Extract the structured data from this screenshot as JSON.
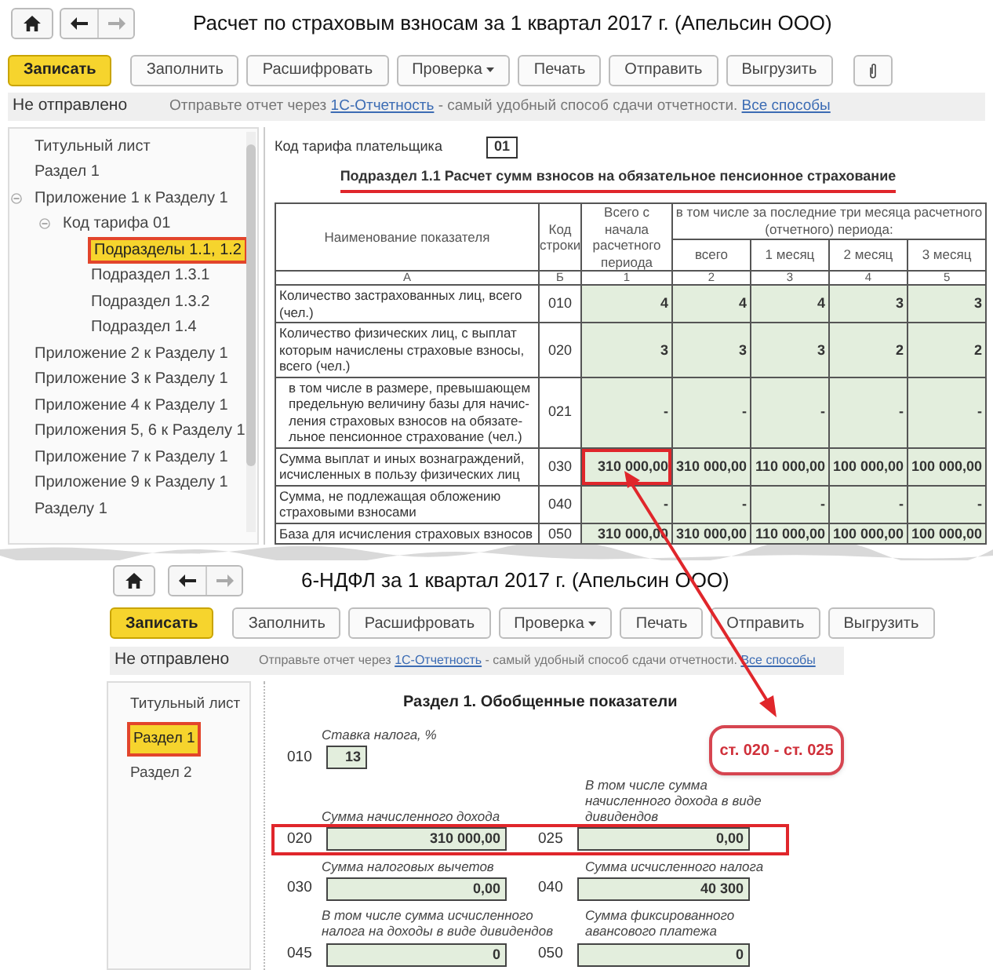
{
  "report_1": {
    "title": "Расчет по страховым взносам за 1 квартал 2017 г. (Апельсин ООО)",
    "toolbar": [
      {
        "label": "Записать",
        "kind": "primary"
      },
      {
        "label": "Заполнить",
        "kind": "plain"
      },
      {
        "label": "Расшифровать",
        "kind": "plain"
      },
      {
        "label": "Проверка",
        "kind": "dropdown"
      },
      {
        "label": "Печать",
        "kind": "plain"
      },
      {
        "label": "Отправить",
        "kind": "plain"
      },
      {
        "label": "Выгрузить",
        "kind": "plain"
      },
      {
        "kind": "attach"
      }
    ],
    "status": {
      "state": "Не отправлено",
      "message": "Отправьте отчет через ",
      "link": "1С-Отчетность",
      "message_after": " - самый удобный способ сдачи отчетности. ",
      "link_2": "Все способы"
    },
    "tree": [
      {
        "label": "Титульный лист",
        "selected": false
      },
      {
        "label": "Раздел 1",
        "selected": false
      },
      {
        "label": "Приложение 1 к Разделу 1",
        "selected": false,
        "expanded": true,
        "children": [
          {
            "label": "Код тарифа 01",
            "selected": false,
            "expanded": true,
            "children": [
              {
                "label": "Подразделы 1.1, 1.2",
                "selected": true
              },
              {
                "label": "Подраздел 1.3.1",
                "selected": false
              },
              {
                "label": "Подраздел 1.3.2",
                "selected": false
              },
              {
                "label": "Подраздел 1.4",
                "selected": false
              }
            ]
          }
        ]
      },
      {
        "label": "Приложение 2 к Разделу 1",
        "selected": false
      },
      {
        "label": "Приложение 3 к Разделу 1",
        "selected": false
      },
      {
        "label": "Приложение 4 к Разделу 1",
        "selected": false
      },
      {
        "label": "Приложения 5, 6 к Разделу 1",
        "selected": false
      },
      {
        "label": "Приложение 7 к Разделу 1",
        "selected": false
      },
      {
        "label": "Приложение 9 к Разделу 1",
        "selected": false
      },
      {
        "label": "Разделу 1",
        "selected": false
      }
    ],
    "form": {
      "tariff_label": "Код тарифа плательщика",
      "tariff_code": "01",
      "section_title": "Подраздел 1.1 Расчет сумм взносов на обязательное пенсионное страхование",
      "table": {
        "col_name": "Наименование показателя",
        "col_code": "Код строки",
        "col_total": "Всего с начала расчетного периода",
        "col_group": "в том числе за последние три месяца расчетного (отчетного) периода:",
        "sub_columns": [
          "всего",
          "1 месяц",
          "2 месяц",
          "3 месяц"
        ],
        "letters": [
          "А",
          "Б",
          "1",
          "2",
          "3",
          "4",
          "5"
        ],
        "rows": [
          {
            "name": "Количество застрахованных лиц, всего (чел.)",
            "code": "010",
            "indented": false,
            "highlighted": false,
            "values": [
              "4",
              "4",
              "4",
              "3",
              "3"
            ]
          },
          {
            "name": "Количество физических лиц, с выплат которым начислены страховые взносы, всего (чел.)",
            "code": "020",
            "indented": false,
            "highlighted": false,
            "values": [
              "3",
              "3",
              "3",
              "2",
              "2"
            ]
          },
          {
            "name": "в том числе в размере, превышающем\nпредельную величину базы для начис-\nления страховых взносов на обязате-\nльное пенсионное страхование (чел.)",
            "code": "021",
            "indented": true,
            "highlighted": false,
            "values": [
              "-",
              "-",
              "-",
              "-",
              "-"
            ]
          },
          {
            "name": "Сумма выплат и иных вознаграждений, исчисленных в пользу физических лиц",
            "code": "030",
            "indented": false,
            "highlighted": true,
            "values": [
              "310 000,00",
              "310 000,00",
              "110 000,00",
              "100 000,00",
              "100 000,00"
            ]
          },
          {
            "name": "Сумма, не подлежащая обложению страховыми взносами",
            "code": "040",
            "indented": false,
            "highlighted": false,
            "values": [
              "-",
              "-",
              "-",
              "-",
              "-"
            ]
          },
          {
            "name": "База для исчисления страховых взносов",
            "code": "050",
            "indented": false,
            "highlighted": false,
            "values": [
              "310 000,00",
              "310 000,00",
              "110 000,00",
              "100 000,00",
              "100 000,00"
            ]
          }
        ]
      }
    }
  },
  "report_2": {
    "title": "6-НДФЛ за 1 квартал 2017 г. (Апельсин ООО)",
    "toolbar": [
      {
        "label": "Записать",
        "kind": "primary"
      },
      {
        "label": "Заполнить",
        "kind": "plain"
      },
      {
        "label": "Расшифровать",
        "kind": "plain"
      },
      {
        "label": "Проверка",
        "kind": "dropdown"
      },
      {
        "label": "Печать",
        "kind": "plain"
      },
      {
        "label": "Отправить",
        "kind": "plain"
      },
      {
        "label": "Выгрузить",
        "kind": "plain"
      }
    ],
    "status": {
      "state": "Не отправлено",
      "message": "Отправьте отчет через ",
      "link": "1С-Отчетность",
      "message_after": " - самый удобный способ сдачи отчетности. ",
      "link_2": "Все способы"
    },
    "tree": [
      {
        "label": "Титульный лист",
        "selected": false
      },
      {
        "label": "Раздел 1",
        "selected": true
      },
      {
        "label": "Раздел 2",
        "selected": false
      }
    ],
    "form": {
      "section_title": "Раздел 1. Обобщенные показатели",
      "field_rows": [
        {
          "highlighted": false,
          "fields": [
            {
              "code": "010",
              "label": "Ставка налога, %",
              "value": "13",
              "kind": "short"
            }
          ]
        },
        {
          "highlighted": true,
          "fields": [
            {
              "code": "020",
              "label": "Сумма начисленного дохода",
              "value": "310 000,00",
              "kind": "amount"
            },
            {
              "code": "025",
              "label": "В том числе сумма начисленного дохода в виде дивидендов",
              "value": "0,00",
              "kind": "amount"
            }
          ]
        },
        {
          "highlighted": false,
          "fields": [
            {
              "code": "030",
              "label": "Сумма налоговых вычетов",
              "value": "0,00",
              "kind": "amount"
            },
            {
              "code": "040",
              "label": "Сумма исчисленного налога",
              "value": "40 300",
              "kind": "amount"
            }
          ]
        },
        {
          "highlighted": false,
          "fields": [
            {
              "code": "045",
              "label": "В том числе сумма исчисленного налога на доходы в виде дивидендов",
              "value": "0",
              "kind": "amount"
            },
            {
              "code": "050",
              "label": "Сумма фиксированного авансового платежа",
              "value": "0",
              "kind": "amount"
            }
          ]
        }
      ]
    }
  },
  "callout": "ст. 020 - ст. 025"
}
